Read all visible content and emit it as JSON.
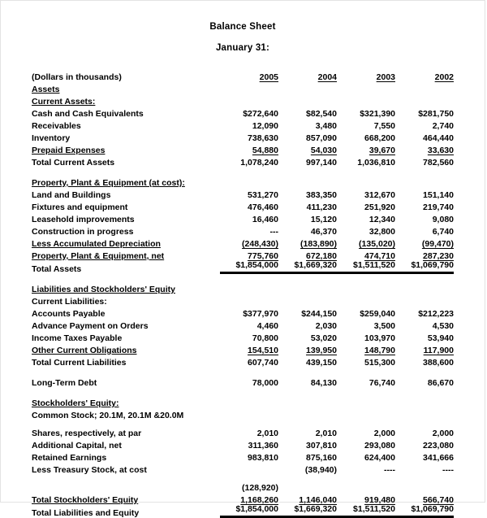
{
  "document": {
    "title": "Balance Sheet",
    "subtitle": "January 31:",
    "units_note": "(Dollars in thousands)"
  },
  "columns": [
    "2005",
    "2004",
    "2003",
    "2002"
  ],
  "sections": {
    "assets_heading": "Assets",
    "current_assets_heading": "Current Assets:",
    "ppe_heading": "Property, Plant & Equipment (at cost):",
    "total_assets_label": "Total Assets",
    "liab_equity_heading": "Liabilities and Stockholders' Equity",
    "current_liab_heading": "Current Liabilities:",
    "long_term_debt_label": "Long-Term Debt",
    "equity_heading": "Stockholders' Equity:",
    "common_stock_note": "Common Stock; 20.1M, 20.1M &20.0M",
    "total_equity_label": "Total Stockholders' Equity",
    "total_liab_equity_label": "Total Liabilities and Equity"
  },
  "rows": {
    "cash": {
      "label": "Cash and Cash Equivalents",
      "v": [
        "$272,640",
        "$82,540",
        "$321,390",
        "$281,750"
      ]
    },
    "receivables": {
      "label": "Receivables",
      "v": [
        "12,090",
        "3,480",
        "7,550",
        "2,740"
      ]
    },
    "inventory": {
      "label": "Inventory",
      "v": [
        "738,630",
        "857,090",
        "668,200",
        "464,440"
      ]
    },
    "prepaid": {
      "label": "Prepaid Expenses",
      "v": [
        "54,880",
        "54,030",
        "39,670",
        "33,630"
      ]
    },
    "total_current_assets": {
      "label": "Total Current Assets",
      "v": [
        "1,078,240",
        "997,140",
        "1,036,810",
        "782,560"
      ]
    },
    "land": {
      "label": "Land and Buildings",
      "v": [
        "531,270",
        "383,350",
        "312,670",
        "151,140"
      ]
    },
    "fixtures": {
      "label": "Fixtures and equipment",
      "v": [
        "476,460",
        "411,230",
        "251,920",
        "219,740"
      ]
    },
    "leasehold": {
      "label": "Leasehold improvements",
      "v": [
        "16,460",
        "15,120",
        "12,340",
        "9,080"
      ]
    },
    "construction": {
      "label": "Construction in progress",
      "v": [
        "---",
        "46,370",
        "32,800",
        "6,740"
      ]
    },
    "accum_dep": {
      "label": "Less Accumulated Depreciation",
      "v": [
        "(248,430)",
        "(183,890)",
        "(135,020)",
        "(99,470)"
      ]
    },
    "ppe_net": {
      "label": "Property, Plant & Equipment, net",
      "v": [
        "775,760",
        "672,180",
        "474,710",
        "287,230"
      ]
    },
    "total_assets": {
      "label": "Total Assets",
      "v": [
        "$1,854,000",
        "$1,669,320",
        "$1,511,520",
        "$1,069,790"
      ]
    },
    "accounts_payable": {
      "label": "Accounts Payable",
      "v": [
        "$377,970",
        "$244,150",
        "$259,040",
        "$212,223"
      ]
    },
    "advance_payment": {
      "label": "Advance Payment on Orders",
      "v": [
        "4,460",
        "2,030",
        "3,500",
        "4,530"
      ]
    },
    "income_taxes": {
      "label": "Income Taxes Payable",
      "v": [
        "70,800",
        "53,020",
        "103,970",
        "53,940"
      ]
    },
    "other_current": {
      "label": "Other Current Obligations",
      "v": [
        "154,510",
        "139,950",
        "148,790",
        "117,900"
      ]
    },
    "total_current_liab": {
      "label": "Total Current Liabilities",
      "v": [
        "607,740",
        "439,150",
        "515,300",
        "388,600"
      ]
    },
    "long_term_debt": {
      "label": "Long-Term Debt",
      "v": [
        "78,000",
        "84,130",
        "76,740",
        "86,670"
      ]
    },
    "shares_at_par": {
      "label": "Shares, respectively, at par",
      "v": [
        "2,010",
        "2,010",
        "2,000",
        "2,000"
      ]
    },
    "additional_capital": {
      "label": "Additional Capital, net",
      "v": [
        "311,360",
        "307,810",
        "293,080",
        "223,080"
      ]
    },
    "retained_earnings": {
      "label": "Retained Earnings",
      "v": [
        "983,810",
        "875,160",
        "624,400",
        "341,666"
      ]
    },
    "treasury_stock": {
      "label": "Less Treasury Stock, at cost",
      "v": [
        "",
        "(38,940)",
        "----",
        "----"
      ]
    },
    "treasury_overflow": {
      "label": "",
      "v": [
        "(128,920)",
        "",
        "",
        ""
      ]
    },
    "total_equity": {
      "label": "Total Stockholders' Equity",
      "v": [
        "1,168,260",
        "1,146,040",
        "919,480",
        "566,740"
      ]
    },
    "total_liab_equity": {
      "label": "Total Liabilities and Equity",
      "v": [
        "$1,854,000",
        "$1,669,320",
        "$1,511,520",
        "$1,069,790"
      ]
    }
  }
}
